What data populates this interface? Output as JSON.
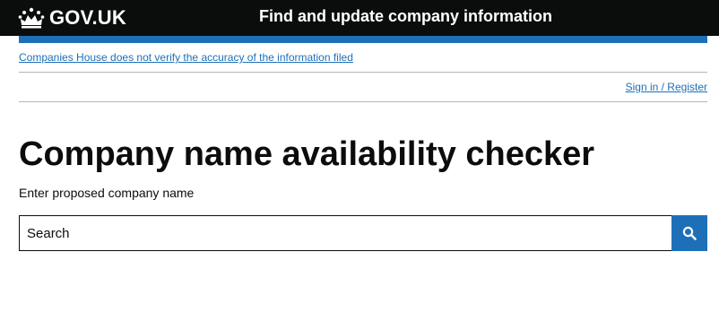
{
  "header": {
    "logo_text": "GOV.UK",
    "service_name": "Find and update company information",
    "colors": {
      "background": "#0b0c0c",
      "text": "#ffffff",
      "accent_bar": "#1d70b8"
    }
  },
  "notice": {
    "disclaimer": "Companies House does not verify the accuracy of the information filed"
  },
  "account": {
    "signin_label": "Sign in / Register"
  },
  "main": {
    "title": "Company name availability checker",
    "hint": "Enter proposed company name",
    "search": {
      "placeholder": "Search",
      "value": "",
      "button_icon": "search-icon"
    }
  },
  "colors": {
    "link": "#1d70b8",
    "text": "#0b0c0c",
    "divider": "#b1b4b6"
  }
}
